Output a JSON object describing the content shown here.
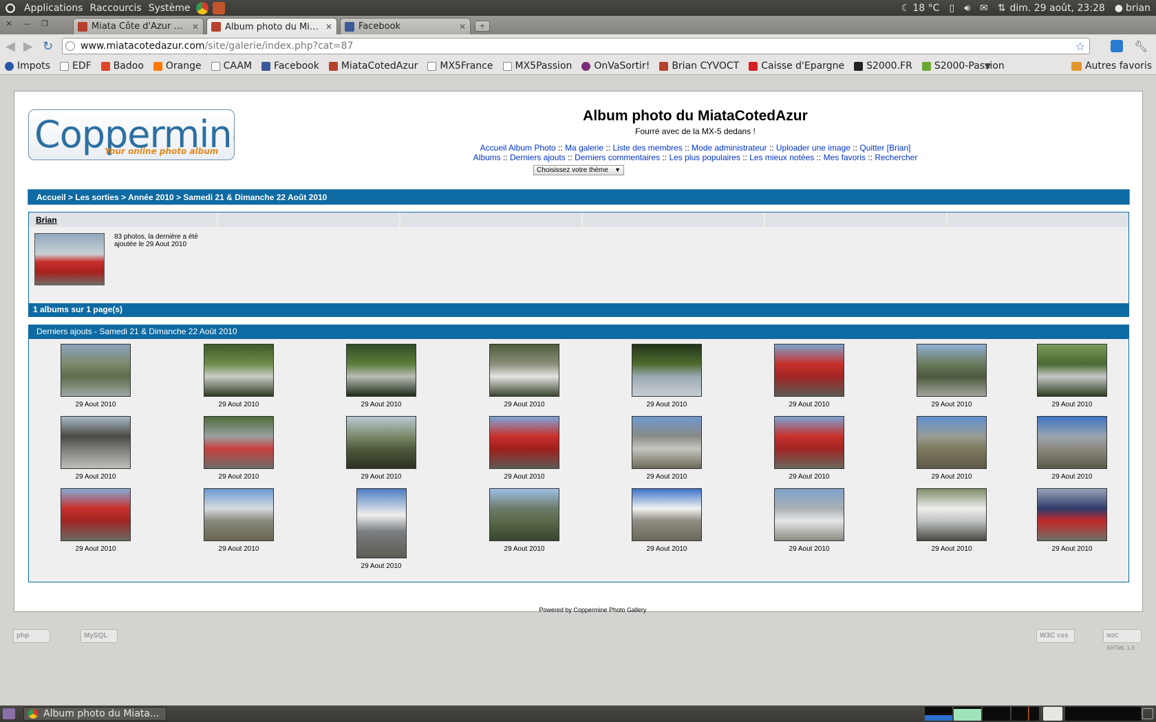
{
  "top_panel": {
    "menus": [
      "Applications",
      "Raccourcis",
      "Système"
    ],
    "weather": "18 °C",
    "datetime": "dim. 29 août, 23:28",
    "user": "brian"
  },
  "tabs": [
    {
      "title": "Miata Côte d'Azur • A...",
      "active": false
    },
    {
      "title": "Album photo du Miat...",
      "active": true
    },
    {
      "title": "Facebook",
      "active": false
    }
  ],
  "omnibox": {
    "host": "www.miatacotedazur.com",
    "path": "/site/galerie/index.php?cat=87"
  },
  "bookmarks": [
    "Impots",
    "EDF",
    "Badoo",
    "Orange",
    "CAAM",
    "Facebook",
    "MiataCotedAzur",
    "MX5France",
    "MX5Passion",
    "OnVaSortir!",
    "Brian CYVOCT",
    "Caisse d'Epargne",
    "S2000.FR",
    "S2000-Passion"
  ],
  "bookmarks_other": "Autres favoris",
  "page": {
    "logo_text": "Coppermine",
    "logo_tagline": "Your online photo album",
    "title": "Album photo du MiataCotedAzur",
    "description": "Fourré avec de la MX-5 dedans !",
    "nav_row1": [
      "Accueil Album Photo",
      "Ma galerie",
      "Liste des membres",
      "Mode administrateur",
      "Uploader une image",
      "Quitter [Brian]"
    ],
    "nav_row2": [
      "Albums",
      "Derniers ajouts",
      "Derniers commentaires",
      "Les plus populaires",
      "Les mieux notées",
      "Mes favoris",
      "Rechercher"
    ],
    "nav_separator": " :: ",
    "theme_select": "Choisissez votre thème",
    "breadcrumb": [
      "Accueil",
      "Les sorties",
      "Année 2010",
      "Samedi 21 & Dimanche 22 Août 2010"
    ],
    "breadcrumb_separator": " > ",
    "album_category": "Brian",
    "album_info": "83 photos, la dernière a été ajoutée le 29 Aout 2010",
    "album_count": "1 albums sur 1 page(s)",
    "latest_title": "Derniers ajouts - Samedi 21 & Dimanche 22 Août 2010",
    "thumb_caption": "29 Aout 2010",
    "powered_by": "Powered by Coppermine Photo Gallery",
    "badges": [
      "php",
      "MySQL",
      "W3C css",
      "W3C XHTML 1.0"
    ]
  },
  "taskbar": {
    "window_title": "Album photo du Miata..."
  },
  "colors": {
    "header_blue": "#0e6aa2",
    "link_blue": "#0033cc",
    "panel_dark": "#3a3835"
  }
}
